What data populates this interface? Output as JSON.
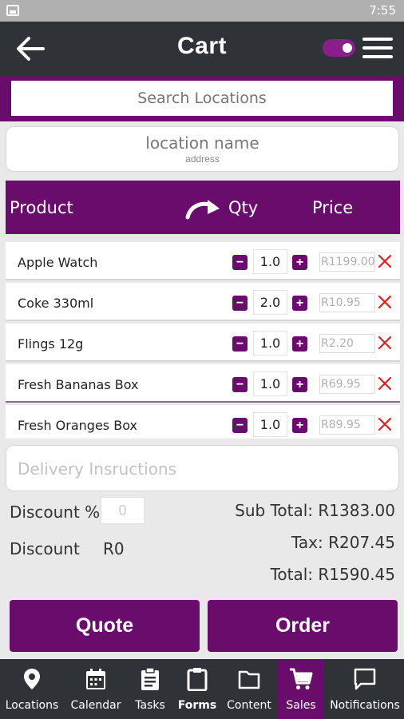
{
  "status_bar": {
    "time": "7:55",
    "gallery_icon": "image-icon"
  },
  "app_bar": {
    "title": "Cart",
    "back_icon": "arrow-left-icon",
    "toggle_icon": "toggle-switch-icon",
    "menu_icon": "hamburger-menu-icon"
  },
  "search": {
    "placeholder": "Search Locations"
  },
  "location": {
    "name": "location name",
    "address": "address"
  },
  "table_header": {
    "product": "Product",
    "qty": "Qty",
    "price": "Price",
    "sort_icon": "curved-arrow-icon"
  },
  "cart_items": [
    {
      "name": "Apple Watch",
      "qty": "1.0",
      "price": "R1199.00"
    },
    {
      "name": "Coke 330ml",
      "qty": "2.0",
      "price": "R10.95"
    },
    {
      "name": "Flings 12g",
      "qty": "1.0",
      "price": "R2.20"
    },
    {
      "name": "Fresh Bananas Box",
      "qty": "1.0",
      "price": "R69.95"
    },
    {
      "name": "Fresh Oranges Box",
      "qty": "1.0",
      "price": "R89.95"
    }
  ],
  "delivery": {
    "placeholder": "Delivery Insructions"
  },
  "discount": {
    "percent_label": "Discount %",
    "percent_value": "0",
    "amount_label": "Discount",
    "amount_value": "R0"
  },
  "totals": {
    "subtotal": "Sub Total: R1383.00",
    "tax": "Tax: R207.45",
    "total": "Total: R1590.45"
  },
  "actions": {
    "quote": "Quote",
    "order": "Order"
  },
  "nav": [
    {
      "label": "Locations",
      "icon": "map-pin-icon"
    },
    {
      "label": "Calendar",
      "icon": "calendar-icon"
    },
    {
      "label": "Tasks",
      "icon": "clipboard-list-icon"
    },
    {
      "label": "Forms",
      "icon": "clipboard-icon"
    },
    {
      "label": "Content",
      "icon": "folder-icon"
    },
    {
      "label": "Sales",
      "icon": "shopping-cart-icon"
    },
    {
      "label": "Notifications",
      "icon": "chat-bubble-icon"
    }
  ],
  "colors": {
    "brand": "#6a0c6b",
    "toolbar": "#2f3338",
    "toggle": "#8a1f8c",
    "remove": "#e02020"
  }
}
